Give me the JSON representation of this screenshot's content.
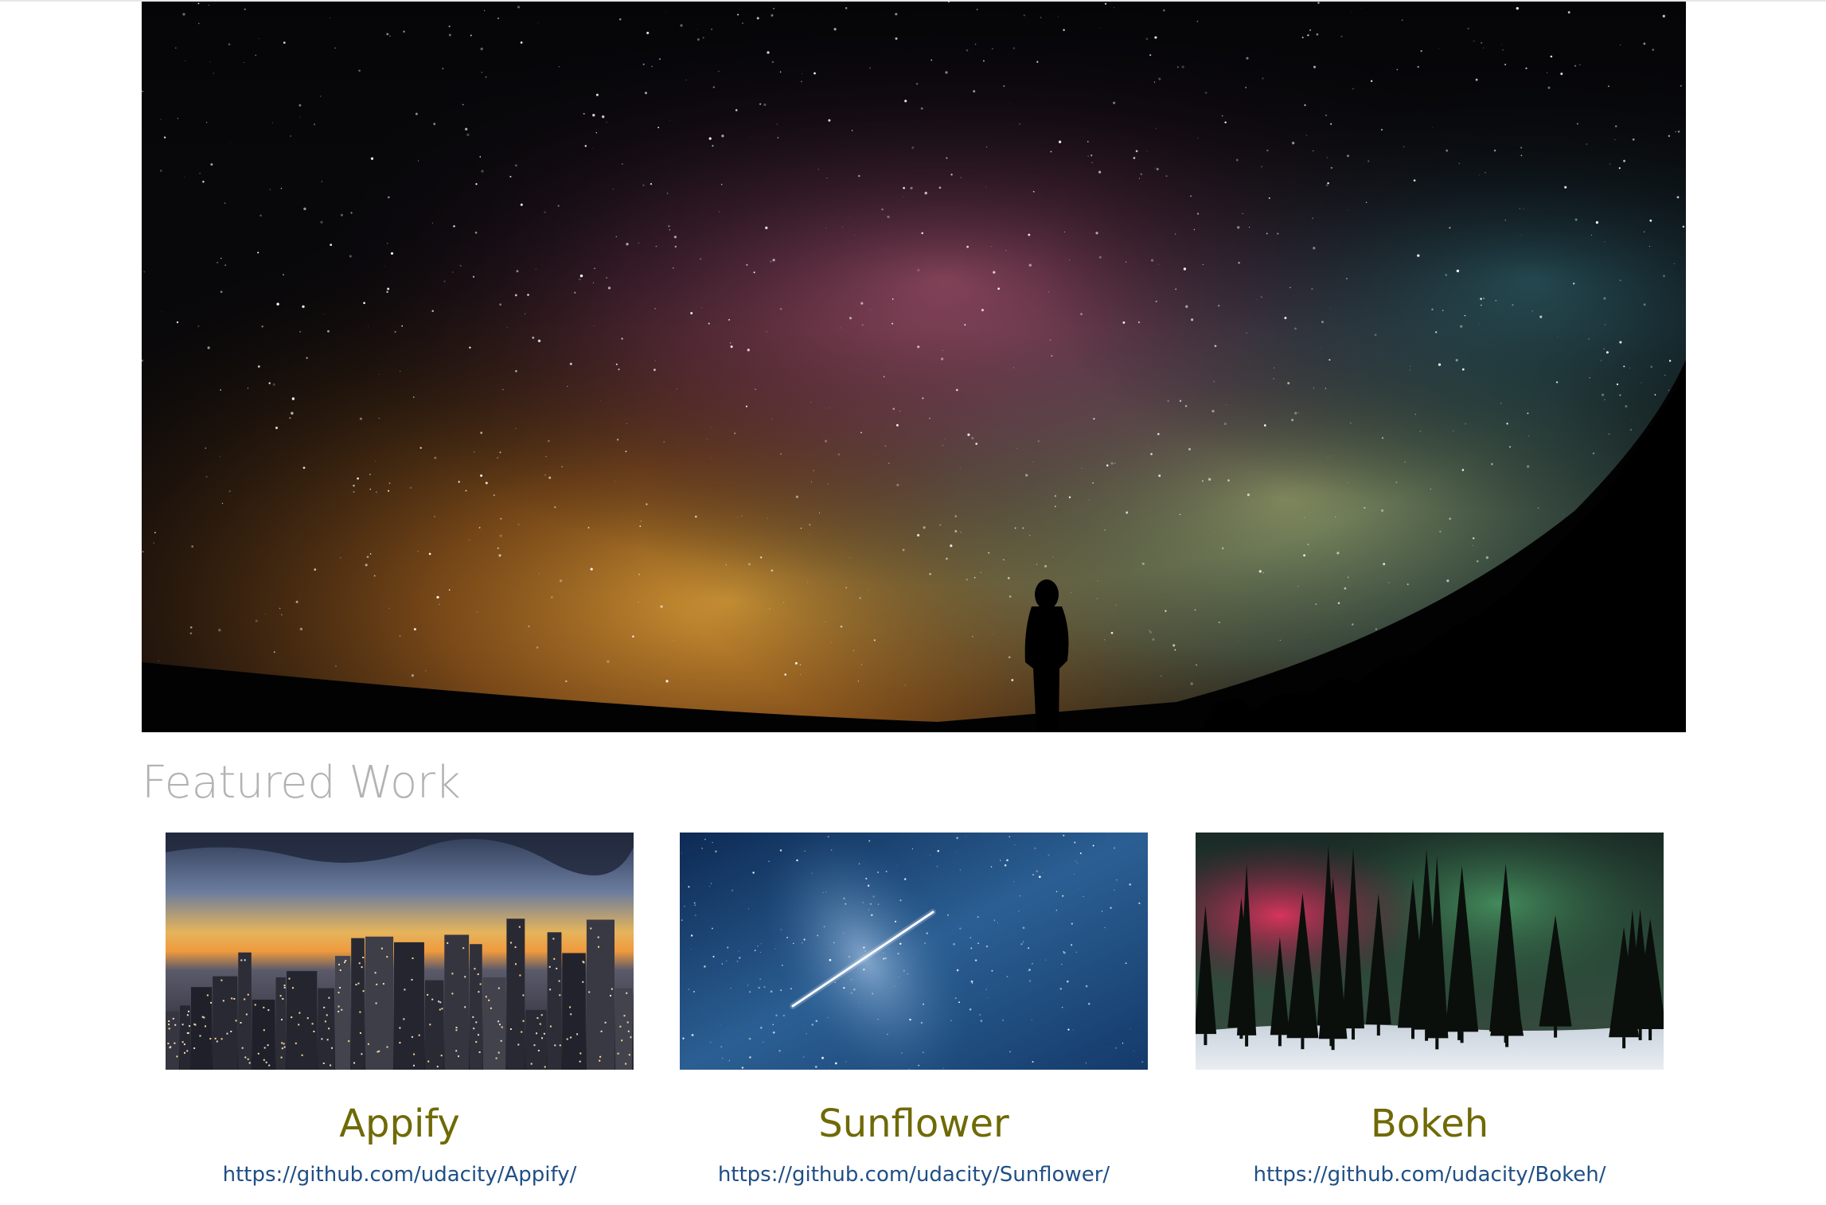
{
  "hero": {
    "image": "milky-way-night-sky-with-silhouette-person-photo"
  },
  "featured": {
    "title": "Featured Work",
    "projects": [
      {
        "image": "city-skyline-at-sunset-photo",
        "title": "Appify",
        "link": "https://github.com/udacity/Appify/"
      },
      {
        "image": "starry-sky-with-shooting-star-photo",
        "title": "Sunflower",
        "link": "https://github.com/udacity/Sunflower/"
      },
      {
        "image": "aurora-over-snowy-forest-photo",
        "title": "Bokeh",
        "link": "https://github.com/udacity/Bokeh/"
      }
    ]
  },
  "colors": {
    "background": "#ffffff",
    "heading": "#b3b3b3",
    "project_title": "#6f6a05",
    "link": "#1f4f86"
  }
}
